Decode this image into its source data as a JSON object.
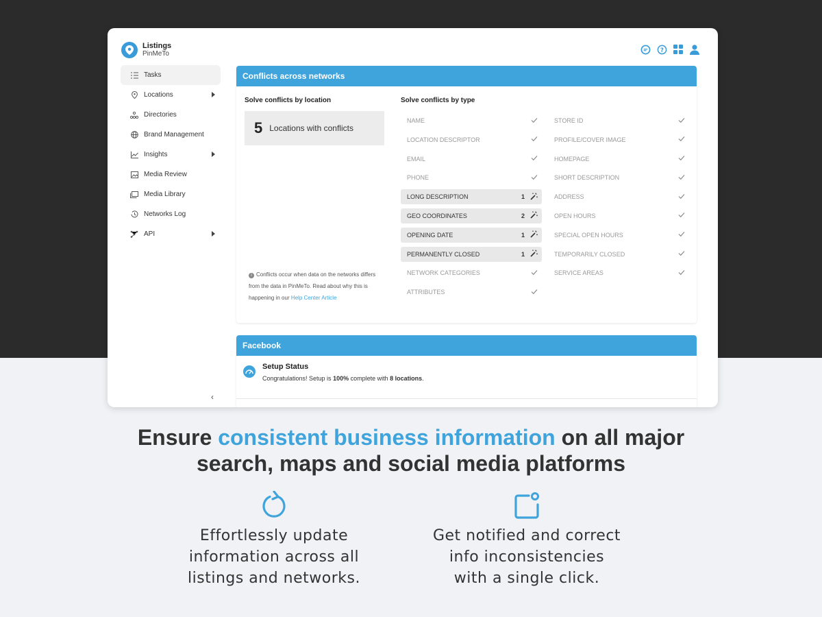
{
  "app": {
    "title": "Listings",
    "subtitle": "PinMeTo"
  },
  "sidebar": {
    "items": [
      {
        "label": "Tasks",
        "icon": "tasks-icon",
        "active": true
      },
      {
        "label": "Locations",
        "icon": "pin-icon",
        "has_submenu": true
      },
      {
        "label": "Directories",
        "icon": "directories-icon"
      },
      {
        "label": "Brand Management",
        "icon": "globe-icon"
      },
      {
        "label": "Insights",
        "icon": "chart-icon",
        "has_submenu": true
      },
      {
        "label": "Media Review",
        "icon": "image-icon"
      },
      {
        "label": "Media Library",
        "icon": "library-icon"
      },
      {
        "label": "Networks Log",
        "icon": "history-icon"
      },
      {
        "label": "API",
        "icon": "api-icon",
        "has_submenu": true
      }
    ],
    "collapse_glyph": "‹"
  },
  "conflicts": {
    "title": "Conflicts across networks",
    "by_location_title": "Solve conflicts by location",
    "locations_count": "5",
    "locations_label": "Locations with conflicts",
    "by_type_title": "Solve conflicts by type",
    "note_text": "Conflicts occur when data on the networks differs from the data in PinMeTo. Read about why this is happening in our ",
    "note_link": "Help Center Article",
    "types_left": [
      {
        "label": "NAME",
        "count": null
      },
      {
        "label": "LOCATION DESCRIPTOR",
        "count": null
      },
      {
        "label": "EMAIL",
        "count": null
      },
      {
        "label": "PHONE",
        "count": null
      },
      {
        "label": "LONG DESCRIPTION",
        "count": "1"
      },
      {
        "label": "GEO COORDINATES",
        "count": "2"
      },
      {
        "label": "OPENING DATE",
        "count": "1"
      },
      {
        "label": "PERMANENTLY CLOSED",
        "count": "1"
      },
      {
        "label": "NETWORK CATEGORIES",
        "count": null
      },
      {
        "label": "ATTRIBUTES",
        "count": null
      }
    ],
    "types_right": [
      {
        "label": "STORE ID",
        "count": null
      },
      {
        "label": "PROFILE/COVER IMAGE",
        "count": null
      },
      {
        "label": "HOMEPAGE",
        "count": null
      },
      {
        "label": "SHORT DESCRIPTION",
        "count": null
      },
      {
        "label": "ADDRESS",
        "count": null
      },
      {
        "label": "OPEN HOURS",
        "count": null
      },
      {
        "label": "SPECIAL OPEN HOURS",
        "count": null
      },
      {
        "label": "TEMPORARILY CLOSED",
        "count": null
      },
      {
        "label": "SERVICE AREAS",
        "count": null
      }
    ]
  },
  "facebook": {
    "title": "Facebook",
    "setup_title": "Setup Status",
    "setup_text_1": "Congratulations! Setup is ",
    "setup_percent": "100%",
    "setup_text_2": " complete with ",
    "setup_locations": "8 locations",
    "setup_text_3": "."
  },
  "marketing": {
    "headline_1": "Ensure ",
    "headline_accent": "consistent business information",
    "headline_2": " on all major",
    "headline_3": "search, maps and social media platforms",
    "feature_1_lines": [
      "Effortlessly update",
      "information across all",
      "listings and networks."
    ],
    "feature_2_lines": [
      "Get notified and correct",
      "info inconsistencies",
      "with a single click."
    ]
  },
  "colors": {
    "accent": "#3fa4dc",
    "dark_bg": "#2b2b2b",
    "light_bg": "#f0f2f5"
  }
}
